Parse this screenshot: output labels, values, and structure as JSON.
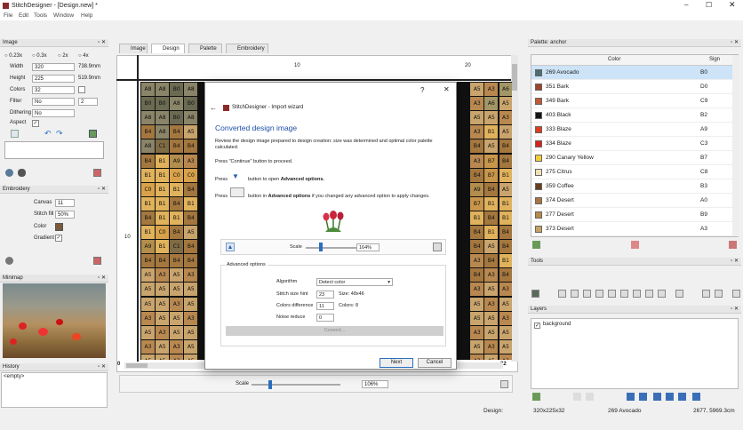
{
  "app": {
    "title": "StitchDesigner - [Design.new] *"
  },
  "menu": [
    "File",
    "Edit",
    "Tools",
    "Window",
    "Help"
  ],
  "image_panel": {
    "title": "Image",
    "zoom_options": [
      "0.23x",
      "0.3x",
      "2x",
      "4x"
    ],
    "width_label": "Width",
    "width_value": "320",
    "width_mm": "738.9mm",
    "height_label": "Height",
    "height_value": "225",
    "height_mm": "519.9mm",
    "colors_label": "Colors",
    "colors_value": "32",
    "filter_label": "Filter",
    "filter_value": "No",
    "filter_num": "2",
    "dithering_label": "Dithering",
    "dithering_value": "No",
    "aspect_label": "Aspect"
  },
  "embroidery_panel": {
    "title": "Embroidery",
    "canvas_label": "Canvas",
    "canvas_value": "11",
    "stitch_fill_label": "Stitch fill",
    "stitch_fill_value": "50%",
    "color_label": "Color",
    "gradient_label": "Gradient"
  },
  "minimap_panel": {
    "title": "Minimap"
  },
  "history_panel": {
    "title": "History",
    "item": "<empty>"
  },
  "tabs": [
    "Image",
    "Design",
    "Palette",
    "Embroidery"
  ],
  "ruler": {
    "top": [
      "10",
      "20"
    ],
    "left": "10",
    "corner_left": "0",
    "corner_right": "22",
    "side": "17"
  },
  "grid_rows": [
    [
      "A8",
      "A8",
      "B0",
      "A8",
      "",
      "",
      "",
      "",
      "",
      "",
      "",
      "",
      "",
      "",
      "",
      "",
      "",
      "",
      "",
      "",
      "",
      "",
      "",
      "A5",
      "A3",
      "A6"
    ],
    [
      "B0",
      "B0",
      "A8",
      "B0",
      "",
      "",
      "",
      "",
      "",
      "",
      "",
      "",
      "",
      "",
      "",
      "",
      "",
      "",
      "",
      "",
      "",
      "",
      "",
      "A3",
      "A6",
      "A5"
    ],
    [
      "A8",
      "A8",
      "B0",
      "A8",
      "",
      "",
      "",
      "",
      "",
      "",
      "",
      "",
      "",
      "",
      "",
      "",
      "",
      "",
      "",
      "",
      "",
      "",
      "",
      "A5",
      "A5",
      "A3"
    ],
    [
      "B4",
      "A8",
      "B4",
      "A5",
      "",
      "",
      "",
      "",
      "",
      "",
      "",
      "",
      "",
      "",
      "",
      "",
      "",
      "",
      "",
      "",
      "",
      "",
      "",
      "A3",
      "B1",
      "A5"
    ],
    [
      "A8",
      "C1",
      "B4",
      "B4",
      "",
      "",
      "",
      "",
      "",
      "",
      "",
      "",
      "",
      "",
      "",
      "",
      "",
      "",
      "",
      "",
      "",
      "",
      "",
      "B4",
      "A5",
      "B4"
    ],
    [
      "B4",
      "B1",
      "A9",
      "A3",
      "",
      "",
      "",
      "",
      "",
      "",
      "",
      "",
      "",
      "",
      "",
      "",
      "",
      "",
      "",
      "",
      "",
      "",
      "",
      "A3",
      "B7",
      "B4"
    ],
    [
      "B1",
      "B1",
      "C0",
      "C0",
      "",
      "",
      "",
      "",
      "",
      "",
      "",
      "",
      "",
      "",
      "",
      "",
      "",
      "",
      "",
      "",
      "",
      "",
      "",
      "B4",
      "B7",
      "B1"
    ],
    [
      "C0",
      "B1",
      "B1",
      "B4",
      "",
      "",
      "",
      "",
      "",
      "",
      "",
      "",
      "",
      "",
      "",
      "",
      "",
      "",
      "",
      "",
      "",
      "",
      "",
      "A9",
      "B4",
      "A5"
    ],
    [
      "B1",
      "B1",
      "B4",
      "B1",
      "",
      "",
      "",
      "",
      "",
      "",
      "",
      "",
      "",
      "",
      "",
      "",
      "",
      "",
      "",
      "",
      "",
      "",
      "",
      "B7",
      "B1",
      "B1"
    ],
    [
      "B4",
      "B1",
      "B1",
      "B4",
      "",
      "",
      "",
      "",
      "",
      "",
      "",
      "",
      "",
      "",
      "",
      "",
      "",
      "",
      "",
      "",
      "",
      "",
      "",
      "B1",
      "B4",
      "B1"
    ],
    [
      "B1",
      "C0",
      "B4",
      "A5",
      "",
      "",
      "",
      "",
      "",
      "",
      "",
      "",
      "",
      "",
      "",
      "",
      "",
      "",
      "",
      "",
      "",
      "",
      "",
      "B4",
      "B1",
      "B4"
    ],
    [
      "A9",
      "B1",
      "C1",
      "B4",
      "",
      "",
      "",
      "",
      "",
      "",
      "",
      "",
      "",
      "",
      "",
      "",
      "",
      "",
      "",
      "",
      "",
      "",
      "",
      "B4",
      "A5",
      "B4"
    ],
    [
      "B4",
      "B4",
      "B4",
      "B4",
      "",
      "",
      "",
      "",
      "",
      "",
      "",
      "",
      "",
      "",
      "",
      "",
      "",
      "",
      "",
      "",
      "",
      "",
      "",
      "A3",
      "B4",
      "B1"
    ],
    [
      "A5",
      "A3",
      "A5",
      "A3",
      "",
      "",
      "",
      "",
      "",
      "",
      "",
      "",
      "",
      "",
      "",
      "",
      "",
      "",
      "",
      "",
      "",
      "",
      "",
      "B4",
      "A3",
      "B4"
    ],
    [
      "A5",
      "A5",
      "A5",
      "A5",
      "",
      "",
      "",
      "",
      "",
      "",
      "",
      "",
      "",
      "",
      "",
      "",
      "",
      "",
      "",
      "",
      "",
      "",
      "",
      "A3",
      "A5",
      "A3"
    ],
    [
      "A5",
      "A5",
      "A3",
      "A5",
      "",
      "",
      "",
      "",
      "",
      "",
      "",
      "",
      "",
      "",
      "",
      "",
      "",
      "",
      "",
      "",
      "",
      "",
      "",
      "A5",
      "A3",
      "A5"
    ],
    [
      "A3",
      "A5",
      "A5",
      "A3",
      "",
      "",
      "",
      "",
      "",
      "",
      "",
      "",
      "",
      "",
      "",
      "",
      "",
      "",
      "",
      "",
      "",
      "",
      "",
      "A5",
      "A5",
      "A3"
    ],
    [
      "A5",
      "A3",
      "A5",
      "A5",
      "",
      "",
      "",
      "",
      "",
      "",
      "",
      "",
      "",
      "",
      "",
      "",
      "",
      "",
      "",
      "",
      "",
      "",
      "",
      "A3",
      "A5",
      "A5"
    ],
    [
      "A3",
      "A5",
      "A3",
      "A5",
      "",
      "",
      "",
      "",
      "",
      "",
      "",
      "",
      "",
      "",
      "",
      "",
      "",
      "",
      "",
      "",
      "",
      "",
      "",
      "A5",
      "A3",
      "A5"
    ],
    [
      "A5",
      "A5",
      "A3",
      "A5",
      "",
      "",
      "",
      "",
      "",
      "",
      "",
      "",
      "",
      "",
      "",
      "",
      "",
      "",
      "",
      "",
      "",
      "",
      "",
      "A3",
      "A5",
      "A3"
    ]
  ],
  "sign_colors": {
    "A8": "#8a8468",
    "B0": "#6b6a52",
    "A5": "#c9a46c",
    "A3": "#b88850",
    "A6": "#a29666",
    "B4": "#a4773e",
    "C1": "#7f6b44",
    "B1": "#e0b25c",
    "A9": "#b38d4c",
    "C0": "#d8a14a",
    "B7": "#c8964a"
  },
  "bottom_scale": {
    "label": "Scale",
    "value": "106%"
  },
  "palette_panel": {
    "title": "Palette: anchor",
    "col_color": "Color",
    "col_sign": "Sign",
    "rows": [
      {
        "name": "269 Avocado",
        "sign": "B0",
        "color": "#4e6e6e"
      },
      {
        "name": "351 Bark",
        "sign": "D0",
        "color": "#a0442a"
      },
      {
        "name": "349 Bark",
        "sign": "C9",
        "color": "#c05a34"
      },
      {
        "name": "403 Black",
        "sign": "B2",
        "color": "#151515"
      },
      {
        "name": "333 Blaze",
        "sign": "A9",
        "color": "#e03c1e"
      },
      {
        "name": "334 Blaze",
        "sign": "C3",
        "color": "#d82418"
      },
      {
        "name": "290 Canary Yellow",
        "sign": "B7",
        "color": "#f4cc3a"
      },
      {
        "name": "275 Citrus",
        "sign": "C8",
        "color": "#f2e0b6"
      },
      {
        "name": "359 Coffee",
        "sign": "B3",
        "color": "#6a3e1e"
      },
      {
        "name": "374 Desert",
        "sign": "A0",
        "color": "#a9733e"
      },
      {
        "name": "277 Desert",
        "sign": "B9",
        "color": "#b58a44"
      },
      {
        "name": "373 Desert",
        "sign": "A3",
        "color": "#c8a060"
      }
    ]
  },
  "tools_panel": {
    "title": "Tools"
  },
  "layers_panel": {
    "title": "Layers",
    "layer": "background"
  },
  "status": {
    "label": "Design:",
    "size": "320x225x32",
    "color": "269 Avocado",
    "dims": "2677, 5969.3cm"
  },
  "dialog": {
    "title": "StitchDesigner - Import wizard",
    "heading": "Converted design image",
    "desc": "Review the design image prepared to design creation: size was determined and optimal color palette calculated.",
    "continue_text": "Press \"Continue\" button to proceed.",
    "press": "Press",
    "adv_text_a": "button to open",
    "adv_text_b": "Advanced options.",
    "adv_text2_a": "button in",
    "adv_text2_b": "Advanced options",
    "adv_text2_c": "if you changed any advanced option to apply changes.",
    "scale_label": "Scale",
    "scale_value": "164%",
    "adv_title": "Advanced options",
    "algorithm_label": "Algorithm",
    "algorithm_value": "Detect color",
    "stitch_label": "Stitch size hint",
    "stitch_value": "23",
    "size_text": "Size: 48x46",
    "colors_diff_label": "Colors difference",
    "colors_diff_value": "11",
    "colors_text": "Colors: 8",
    "noise_label": "Noise reduce",
    "noise_value": "0",
    "convert_label": "Convert...",
    "next_label": "Next",
    "cancel_label": "Cancel"
  }
}
